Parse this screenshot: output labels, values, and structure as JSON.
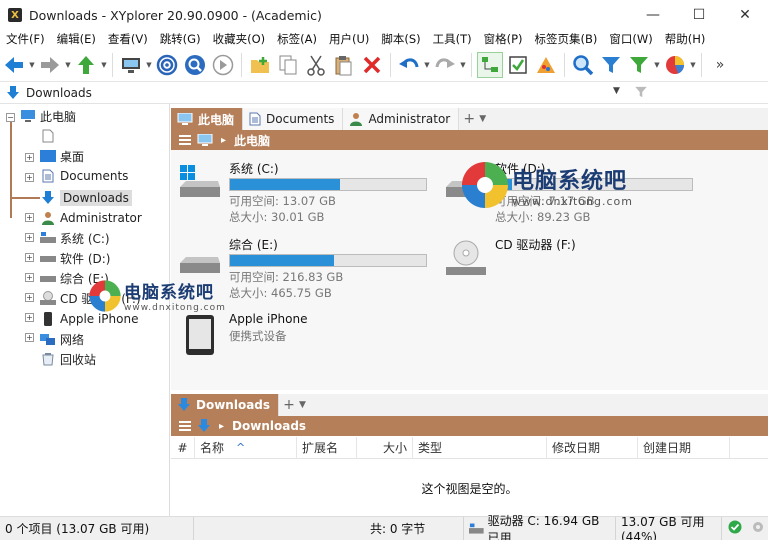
{
  "window": {
    "title": "Downloads - XYplorer 20.90.0900 - (Academic)",
    "app_glyph": "X",
    "minimize": "—",
    "maximize": "☐",
    "close": "✕"
  },
  "menu": [
    "文件(F)",
    "编辑(E)",
    "查看(V)",
    "跳转(G)",
    "收藏夹(O)",
    "标签(A)",
    "用户(U)",
    "脚本(S)",
    "工具(T)",
    "窗格(P)",
    "标签页集(B)",
    "窗口(W)",
    "帮助(H)"
  ],
  "toolbar": {
    "icons": [
      "back-arrow-icon",
      "forward-arrow-icon",
      "up-arrow-icon",
      "computer-icon",
      "target-icon",
      "search-icon",
      "circle-arrow-icon",
      "new-folder-icon",
      "copy-icon",
      "cut-icon",
      "paste-icon",
      "delete-icon",
      "undo-icon",
      "redo-icon",
      "tree-icon",
      "checkbox-icon",
      "color-icon",
      "find-icon",
      "filter-icon",
      "filter-green-icon",
      "pie-icon"
    ],
    "more": "»"
  },
  "address": {
    "value": "Downloads"
  },
  "tree": {
    "root": "此电脑",
    "items": [
      "桌面",
      "Documents",
      "Downloads",
      "Administrator",
      "系统 (C:)",
      "软件 (D:)",
      "综合 (E:)",
      "CD 驱动器 (F:)",
      "Apple iPhone",
      "网络",
      "回收站"
    ],
    "selected": "Downloads"
  },
  "top_pane": {
    "tabs": [
      {
        "label": "此电脑",
        "active": true
      },
      {
        "label": "Documents",
        "active": false
      },
      {
        "label": "Administrator",
        "active": false
      }
    ],
    "plus": "+",
    "arrow": "▼",
    "breadcrumb": "此电脑",
    "breadcrumb_sep": "▸",
    "drives": [
      {
        "name": "系统 (C:)",
        "free": "可用空间: 13.07 GB",
        "total": "总大小: 30.01 GB",
        "used_fraction": 0.56
      },
      {
        "name": "软件 (D:)",
        "free": "可用空间: 7.17 GB",
        "total": "总大小: 89.23 GB",
        "used_fraction": 0.08
      },
      {
        "name": "综合 (E:)",
        "free": "可用空间: 216.83 GB",
        "total": "总大小: 465.75 GB",
        "used_fraction": 0.53
      },
      {
        "name": "CD 驱动器 (F:)"
      },
      {
        "name": "Apple iPhone",
        "sub": "便携式设备"
      }
    ]
  },
  "bottom_pane": {
    "tab": "Downloads",
    "plus": "+",
    "arrow": "▼",
    "breadcrumb": "Downloads",
    "breadcrumb_sep": "▸",
    "columns": [
      "#",
      "名称",
      "扩展名",
      "大小",
      "类型",
      "修改日期",
      "创建日期"
    ],
    "sort_arrow": "^",
    "empty_message": "这个视图是空的。"
  },
  "status": {
    "items": "0 个项目 (13.07 GB 可用)",
    "total": "共: 0 字节",
    "drive": "驱动器 C:  16.94 GB 已用",
    "free": "13.07 GB 可用(44%)"
  },
  "watermark": {
    "text": "电脑系统吧",
    "url": "www.dnxitong.com"
  },
  "colors": {
    "accent_brown": "#b57f5a",
    "bar_blue": "#2a90d8"
  }
}
